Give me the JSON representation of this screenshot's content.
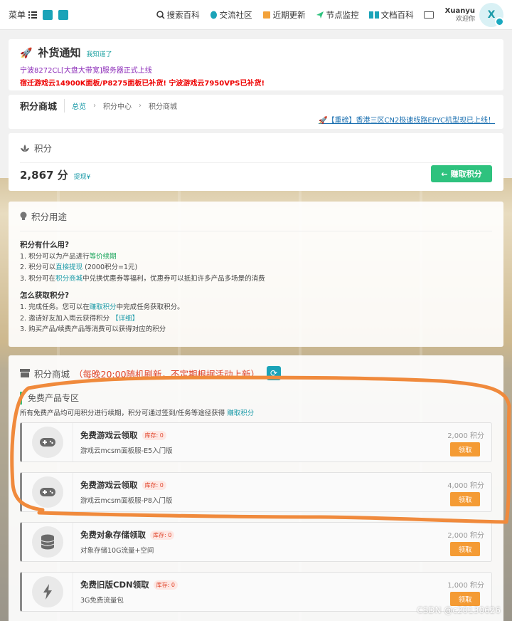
{
  "nav": {
    "menu": "菜单",
    "items": [
      {
        "label": "搜索百科",
        "icon": "search-icon"
      },
      {
        "label": "交流社区",
        "icon": "community-icon"
      },
      {
        "label": "近期更新",
        "icon": "update-icon"
      },
      {
        "label": "节点监控",
        "icon": "monitor-icon"
      },
      {
        "label": "文档百科",
        "icon": "book-icon"
      }
    ],
    "user_name": "Xuanyu",
    "user_sub": "欢迎你",
    "avatar_letter": "X"
  },
  "notice": {
    "title": "补货通知",
    "ack": "我知道了",
    "line1": "宁波8272CL[大盘大带宽]服务器正式上线",
    "line2": "宿迁游戏云14900K面板/P8275面板已补货! 宁波游戏云7950VPS已补货!"
  },
  "breadcrumb": {
    "title": "积分商城",
    "items": [
      "总览",
      "积分中心",
      "积分商城"
    ],
    "announcement": "🚀【重磅】香港三区CN2极速线路EPYC机型现已上线！"
  },
  "points": {
    "header": "积分",
    "value": "2,867 分",
    "withdraw": "提现¥",
    "earn_button": "赚取积分"
  },
  "usage": {
    "header": "积分用途",
    "q1": "积分有什么用?",
    "l1a": "1. 积分可以为产品进行",
    "l1b": "等价续期",
    "l2a": "2. 积分可以",
    "l2b": "直接提现",
    "l2c": " (2000积分=1元)",
    "l3a": "3. 积分可在",
    "l3b": "积分商城",
    "l3c": "中兑换优惠券等福利，优惠券可以抵扣许多产品多场景的消费",
    "q2": "怎么获取积分?",
    "m1a": "1. 完成任务。您可以在",
    "m1b": "赚取积分",
    "m1c": "中完成任务获取积分。",
    "m2a": "2. 邀请好友加入雨云获得积分 ",
    "m2b": "【详细】",
    "m3": "3. 购买产品/续费产品等消费可以获得对应的积分"
  },
  "shop": {
    "header": "积分商城",
    "notice": "（每晚20:00随机刷新，不定期根据活动上新）",
    "section": "免费产品专区",
    "desc_a": "所有免费产品均可用积分进行续期，积分可通过签到/任务等途径获得 ",
    "desc_b": "赚取积分",
    "items": [
      {
        "name": "免费游戏云领取",
        "stock": "库存: 0",
        "desc": "游戏云mcsm面板服-E5入门版",
        "price": "2,000 积分",
        "button": "领取",
        "icon": "gamepad-icon"
      },
      {
        "name": "免费游戏云领取",
        "stock": "库存: 0",
        "desc": "游戏云mcsm面板服-P8入门版",
        "price": "4,000 积分",
        "button": "领取",
        "icon": "gamepad-icon"
      },
      {
        "name": "免费对象存储领取",
        "stock": "库存: 0",
        "desc": "对象存储10G流量+空间",
        "price": "2,000 积分",
        "button": "领取",
        "icon": "database-icon"
      },
      {
        "name": "免费旧版CDN领取",
        "stock": "库存: 0",
        "desc": "3G免费流量包",
        "price": "1,000 积分",
        "button": "领取",
        "icon": "bolt-icon"
      }
    ]
  },
  "watermark": "CSDN @c20130626",
  "colors": {
    "accent": "#1a9aa8",
    "green": "#2ec27e",
    "orange": "#f49b34",
    "annotation": "#f08a3c",
    "red": "#e0442a"
  }
}
